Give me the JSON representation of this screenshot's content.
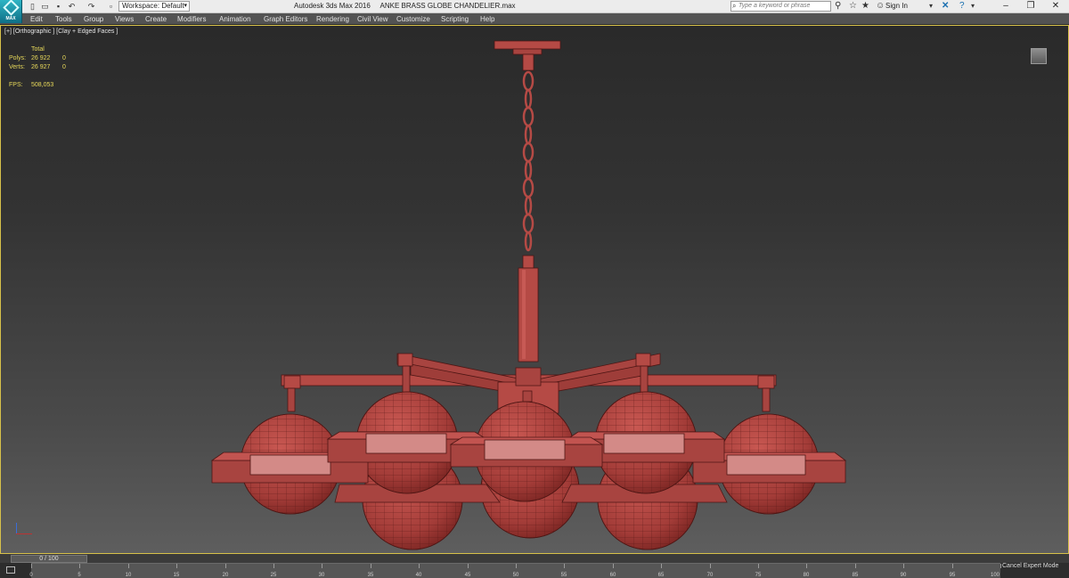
{
  "titlebar": {
    "app_logo_text": "MAX",
    "workspace": "Workspace: Default",
    "app_name": "Autodesk 3ds Max 2016",
    "file_name": "ANKE BRASS GLOBE CHANDELIER.max",
    "search_placeholder": "Type a keyword or phrase",
    "sign_in": "Sign In"
  },
  "menu": [
    "Edit",
    "Tools",
    "Group",
    "Views",
    "Create",
    "Modifiers",
    "Animation",
    "Graph Editors",
    "Rendering",
    "Civil View",
    "Customize",
    "Scripting",
    "Help"
  ],
  "viewport": {
    "label": "[+] [Orthographic ] [Clay + Edged Faces ]",
    "stats": {
      "header": "Total",
      "polys_label": "Polys:",
      "polys_total": "26 922",
      "polys_sel": "0",
      "verts_label": "Verts:",
      "verts_total": "26 927",
      "verts_sel": "0",
      "fps_label": "FPS:",
      "fps_value": "508,053"
    },
    "model_color": "#b54a45",
    "background_color": "#333333"
  },
  "timeline": {
    "slider": "0 / 100",
    "ticks": [
      "0",
      "5",
      "10",
      "15",
      "20",
      "25",
      "30",
      "35",
      "40",
      "45",
      "50",
      "55",
      "60",
      "65",
      "70",
      "75",
      "80",
      "85",
      "90",
      "95",
      "100"
    ],
    "status": "Cancel Expert Mode"
  },
  "icons": [
    "app-logo-icon",
    "new-icon",
    "open-icon",
    "save-icon",
    "undo-icon",
    "redo-icon",
    "search-icon",
    "binoculars-icon",
    "star-icon",
    "user-icon",
    "help-icon"
  ]
}
